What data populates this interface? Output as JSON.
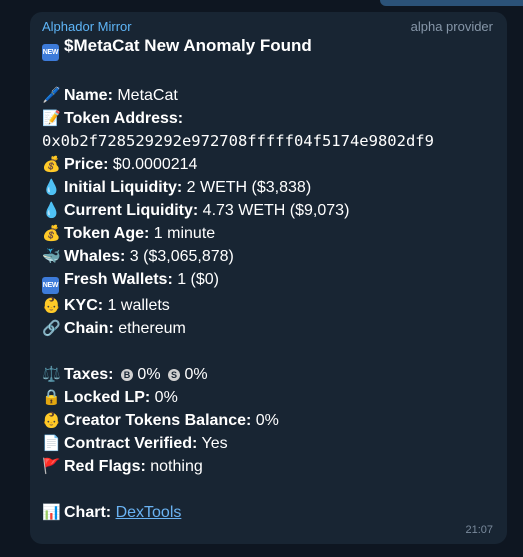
{
  "message": {
    "sender": "Alphador Mirror",
    "provider": "alpha provider",
    "new_badge": "NEW",
    "title": "$MetaCat New Anomaly Found",
    "name_label": "Name:",
    "name_value": " MetaCat",
    "address_label": "Token Address:",
    "address_value": "0x0b2f728529292e972708fffff04f5174e9802df9",
    "price_label": "Price:",
    "price_value": " $0.0000214",
    "init_liq_label": "Initial Liquidity:",
    "init_liq_value": " 2 WETH ($3,838)",
    "curr_liq_label": "Current Liquidity:",
    "curr_liq_value": " 4.73 WETH ($9,073)",
    "age_label": "Token Age:",
    "age_value": " 1 minute",
    "whales_label": "Whales:",
    "whales_value": " 3 ($3,065,878)",
    "fresh_label": "Fresh Wallets:",
    "fresh_value": " 1 ($0)",
    "kyc_label": "KYC:",
    "kyc_value": " 1 wallets",
    "chain_label": "Chain:",
    "chain_value": " ethereum",
    "taxes_label": "Taxes:",
    "tax_buy_symbol": "B",
    "tax_buy_value": " 0%",
    "tax_sell_symbol": "S",
    "tax_sell_value": " 0%",
    "locked_label": "Locked LP:",
    "locked_value": " 0%",
    "creator_label": "Creator Tokens Balance:",
    "creator_value": " 0%",
    "verified_label": "Contract Verified:",
    "verified_value": " Yes",
    "flags_label": "Red Flags:",
    "flags_value": " nothing",
    "chart_label": "Chart:",
    "chart_link": "DexTools",
    "time": "21:07"
  },
  "icons": {
    "title": "new-badge",
    "name": "pen-icon",
    "address": "memo-icon",
    "price": "money-bag-icon",
    "initial_liquidity": "droplet-icon",
    "current_liquidity": "droplet-icon",
    "age": "money-bag-icon",
    "whales": "whale-icon",
    "fresh": "new-badge",
    "kyc": "baby-face-icon",
    "chain": "link-icon",
    "taxes": "scales-icon",
    "locked": "lock-icon",
    "creator": "baby-face-icon",
    "verified": "page-icon",
    "flags": "red-flag-icon",
    "chart": "bar-chart-icon"
  },
  "colors": {
    "background": "#0e1621",
    "bubble": "#182533",
    "sender": "#5eb5f7",
    "link": "#6ab3f3"
  }
}
